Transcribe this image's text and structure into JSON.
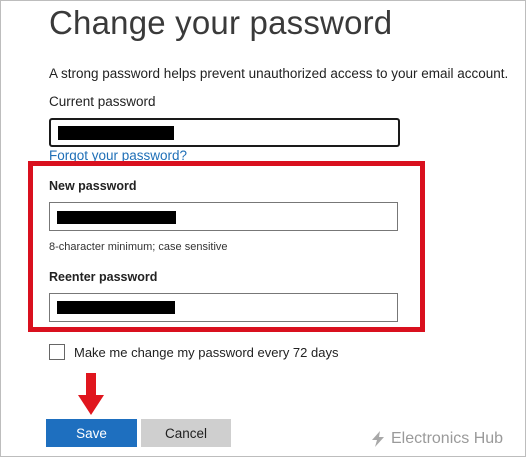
{
  "page": {
    "title": "Change your password",
    "description": "A strong password helps prevent unauthorized access to your email account."
  },
  "current": {
    "label": "Current password"
  },
  "forgot_link": "Forgot your password?",
  "new_password": {
    "label": "New password",
    "hint": "8-character minimum; case sensitive"
  },
  "reenter": {
    "label": "Reenter password"
  },
  "checkbox": {
    "label": "Make me change my password every 72 days",
    "checked": false
  },
  "buttons": {
    "save": "Save",
    "cancel": "Cancel"
  },
  "watermark": {
    "text": "Electronics Hub"
  },
  "colors": {
    "highlight": "#d9101e",
    "accent_button": "#1e6fbf",
    "link": "#1f6fb7",
    "arrow": "#e0161e"
  }
}
